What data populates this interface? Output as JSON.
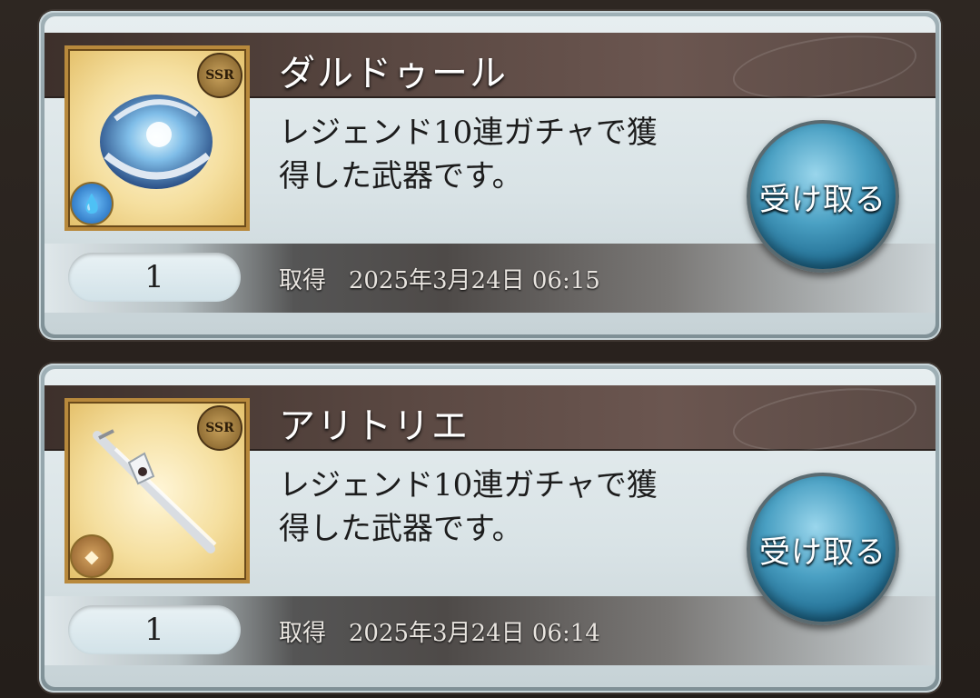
{
  "items": [
    {
      "name": "ダルドゥール",
      "description_line1": "レジェンド10連ガチャで獲",
      "description_line2": "得した武器です。",
      "quantity": "1",
      "obtained_label": "取得",
      "obtained_date": "2025年3月24日 06:15",
      "rarity": "SSR",
      "element": "water",
      "element_icon": "water-drop-icon",
      "receive_label": "受け取る"
    },
    {
      "name": "アリトリエ",
      "description_line1": "レジェンド10連ガチャで獲",
      "description_line2": "得した武器です。",
      "quantity": "1",
      "obtained_label": "取得",
      "obtained_date": "2025年3月24日 06:14",
      "rarity": "SSR",
      "element": "earth",
      "element_icon": "earth-crystal-icon",
      "receive_label": "受け取る"
    }
  ],
  "colors": {
    "receive_button": "#2b87b3",
    "name_bar": "#4a3a34",
    "frame_gold": "#b8893c"
  }
}
